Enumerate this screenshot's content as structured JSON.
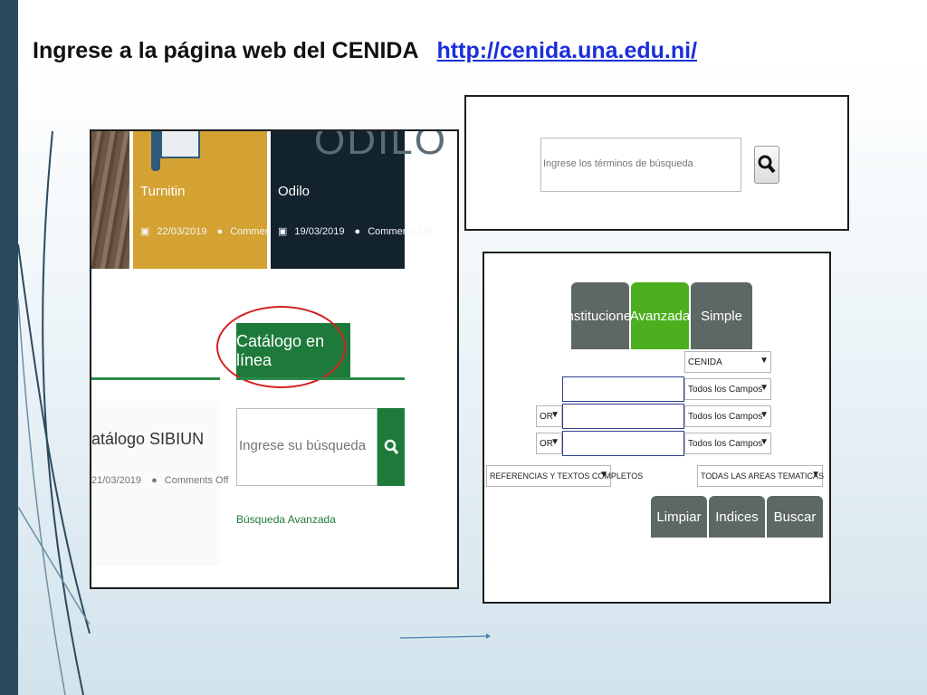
{
  "slide": {
    "title": "Ingrese a la página web del CENIDA",
    "url": "http://cenida.una.edu.ni/"
  },
  "panel_website": {
    "cards": [
      {
        "name": "Turnitin",
        "date": "22/03/2019",
        "comments": "Comments Off"
      },
      {
        "name": "Odilo",
        "date": "19/03/2019",
        "comments": "Comments Off"
      }
    ],
    "card_big_text": "ODILO",
    "catalog_button": "Catálogo en línea",
    "sibiun_title": "atálogo SIBIUN",
    "sibiun_date": "21/03/2019",
    "sibiun_comments": "Comments Off",
    "search_placeholder": "Ingrese su búsqueda",
    "advanced_link": "Búsqueda Avanzada"
  },
  "panel_search": {
    "search_placeholder": "Ingrese los términos de búsqueda"
  },
  "panel_advanced": {
    "tabs": [
      "Instituciones",
      "Avanzada",
      "Simple"
    ],
    "institution_select": "CENIDA",
    "field_selects": [
      "Todos los Campos",
      "Todos los Campos",
      "Todos los Campos"
    ],
    "operator_selects": [
      "OR",
      "OR"
    ],
    "type_select": "REFERENCIAS Y TEXTOS COMPLETOS",
    "area_select": "TODAS LAS AREAS TEMATICAS",
    "buttons": [
      "Limpiar",
      "Indices",
      "Buscar"
    ]
  },
  "colors": {
    "green_button": "#1e7a3a",
    "active_tab": "#4caf1f",
    "gray_tab": "#5d6864",
    "highlight_circle": "#d42020",
    "link": "#1a2fd8"
  }
}
